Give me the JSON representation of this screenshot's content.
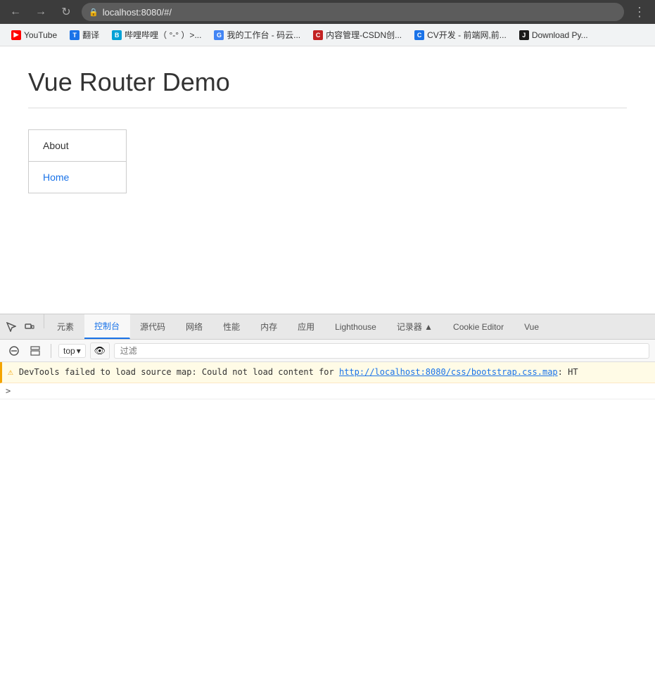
{
  "browser": {
    "url": "localhost:8080/#/",
    "back_label": "←",
    "forward_label": "→",
    "reload_label": "↻",
    "menu_label": "⋮",
    "lock_icon": "🔒"
  },
  "bookmarks": [
    {
      "id": "youtube",
      "label": "YouTube",
      "favicon_class": "fav-youtube",
      "favicon_text": "▶"
    },
    {
      "id": "translate",
      "label": "翻译",
      "favicon_class": "fav-translate",
      "favicon_text": "T"
    },
    {
      "id": "bilibili",
      "label": "哔哩哔哩（ °-° ）>...",
      "favicon_class": "fav-bilibili",
      "favicon_text": "B"
    },
    {
      "id": "google",
      "label": "我的工作台 - 码云...",
      "favicon_class": "fav-google",
      "favicon_text": "G"
    },
    {
      "id": "csdn",
      "label": "内容管理-CSDN创...",
      "favicon_class": "fav-csdn",
      "favicon_text": "C"
    },
    {
      "id": "cv",
      "label": "CV开发 - 前端网,前...",
      "favicon_class": "fav-cv",
      "favicon_text": "C"
    },
    {
      "id": "jb",
      "label": "Download Py...",
      "favicon_class": "fav-jb",
      "favicon_text": "J"
    }
  ],
  "page": {
    "title": "Vue Router Demo",
    "nav_items": [
      {
        "id": "about",
        "label": "About",
        "active": false
      },
      {
        "id": "home",
        "label": "Home",
        "active": true
      }
    ]
  },
  "devtools": {
    "tabs": [
      {
        "id": "elements",
        "label": "元素",
        "active": false
      },
      {
        "id": "console",
        "label": "控制台",
        "active": true
      },
      {
        "id": "sources",
        "label": "源代码",
        "active": false
      },
      {
        "id": "network",
        "label": "网络",
        "active": false
      },
      {
        "id": "performance",
        "label": "性能",
        "active": false
      },
      {
        "id": "memory",
        "label": "内存",
        "active": false
      },
      {
        "id": "application",
        "label": "应用",
        "active": false
      },
      {
        "id": "lighthouse",
        "label": "Lighthouse",
        "active": false
      },
      {
        "id": "recorder",
        "label": "记录器 ▲",
        "active": false
      },
      {
        "id": "cookie_editor",
        "label": "Cookie Editor",
        "active": false
      },
      {
        "id": "vue",
        "label": "Vue",
        "active": false
      }
    ],
    "toolbar": {
      "top_label": "top",
      "filter_placeholder": "过滤",
      "clear_icon": "🚫",
      "eye_icon": "👁"
    },
    "console": {
      "error_text": "DevTools failed to load source map: Could not load content for ",
      "error_link": "http://localhost:8080/css/bootstrap.css.map",
      "error_suffix": ": HT",
      "prompt": ">"
    }
  }
}
